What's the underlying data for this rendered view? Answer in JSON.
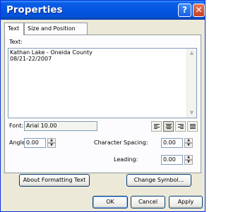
{
  "window": {
    "title": "Properties",
    "help_glyph": "?",
    "close_glyph": "✕"
  },
  "tabs": [
    {
      "label": "Text"
    },
    {
      "label": "Size and Position"
    }
  ],
  "text_section": {
    "label": "Text:",
    "lines": [
      "Kathan Lake - Oneida County",
      "08/21-22/2007"
    ]
  },
  "font": {
    "label": "Font:",
    "value": "Arial 10.00"
  },
  "angle": {
    "label": "Angle:",
    "value": "0.00"
  },
  "character_spacing": {
    "label": "Character Spacing:",
    "value": "0.00"
  },
  "leading": {
    "label": "Leading:",
    "value": "0.00"
  },
  "buttons": {
    "about_formatting": "About Formatting Text",
    "change_symbol": "Change Symbol...",
    "ok": "OK",
    "cancel": "Cancel",
    "apply": "Apply"
  },
  "alignment": {
    "selected": "center"
  },
  "colors": {
    "titlebar": "#0554e3",
    "dialog_bg": "#ece9d8",
    "button_border": "#003c74"
  }
}
